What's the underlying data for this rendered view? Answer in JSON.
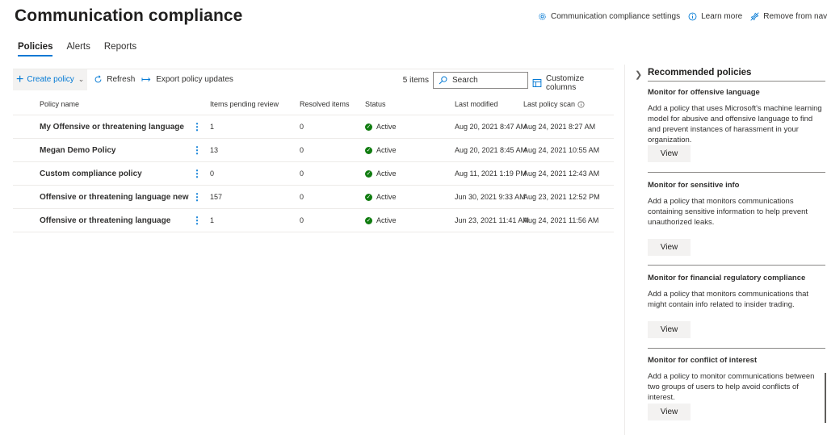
{
  "page": {
    "title": "Communication compliance"
  },
  "header_links": [
    {
      "label": "Communication compliance settings",
      "icon": "gear-icon"
    },
    {
      "label": "Learn more",
      "icon": "info-icon"
    },
    {
      "label": "Remove from navigation",
      "icon": "unpin-icon"
    }
  ],
  "tabs": [
    {
      "label": "Policies",
      "active": true
    },
    {
      "label": "Alerts",
      "active": false
    },
    {
      "label": "Reports",
      "active": false
    }
  ],
  "toolbar": {
    "create_label": "Create policy",
    "refresh_label": "Refresh",
    "export_label": "Export policy updates",
    "items_count": "5 items",
    "search_placeholder": "Search",
    "customize_label": "Customize columns"
  },
  "table": {
    "columns": {
      "name": "Policy name",
      "pending": "Items pending review",
      "resolved": "Resolved items",
      "status": "Status",
      "modified": "Last modified",
      "scan": "Last policy scan"
    },
    "rows": [
      {
        "name": "My Offensive or threatening language",
        "pending": "1",
        "resolved": "0",
        "status": "Active",
        "modified": "Aug 20, 2021 8:47 AM",
        "scan": "Aug 24, 2021 8:27 AM"
      },
      {
        "name": "Megan Demo Policy",
        "pending": "13",
        "resolved": "0",
        "status": "Active",
        "modified": "Aug 20, 2021 8:45 AM",
        "scan": "Aug 24, 2021 10:55 AM"
      },
      {
        "name": "Custom compliance policy",
        "pending": "0",
        "resolved": "0",
        "status": "Active",
        "modified": "Aug 11, 2021 1:19 PM",
        "scan": "Aug 24, 2021 12:43 AM"
      },
      {
        "name": "Offensive or threatening language new",
        "pending": "157",
        "resolved": "0",
        "status": "Active",
        "modified": "Jun 30, 2021 9:33 AM",
        "scan": "Aug 23, 2021 12:52 PM"
      },
      {
        "name": "Offensive or threatening language",
        "pending": "1",
        "resolved": "0",
        "status": "Active",
        "modified": "Jun 23, 2021 11:41 AM",
        "scan": "Aug 24, 2021 11:56 AM"
      }
    ]
  },
  "panel": {
    "title": "Recommended policies",
    "items": [
      {
        "title": "Monitor for offensive language",
        "desc": "Add a policy that uses Microsoft's machine learning model for abusive and offensive language to find and prevent instances of harassment in your organization.",
        "button": "View"
      },
      {
        "title": "Monitor for sensitive info",
        "desc": "Add a policy that monitors communications containing sensitive information to help prevent unauthorized leaks.",
        "button": "View"
      },
      {
        "title": "Monitor for financial regulatory compliance",
        "desc": "Add a policy that monitors communications that might contain info related to insider trading.",
        "button": "View"
      },
      {
        "title": "Monitor for conflict of interest",
        "desc": "Add a policy to monitor communications between two groups of users to help avoid conflicts of interest.",
        "button": "View"
      }
    ]
  },
  "colors": {
    "accent": "#0078d4",
    "status_active": "#107c10"
  }
}
